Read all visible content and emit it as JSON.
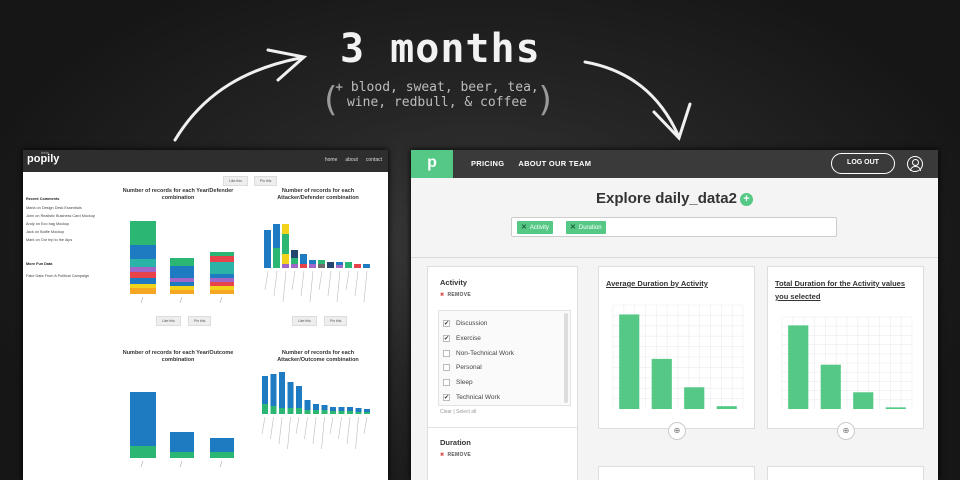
{
  "headline": "3 months",
  "extras_lines": [
    "+ blood, sweat, beer, tea,",
    "wine, redbull, & coffee"
  ],
  "old_app": {
    "logo": "popily",
    "logo_small": "beta",
    "nav": [
      "home",
      "about",
      "contact"
    ],
    "filter_buttons": [
      "Like this",
      "Pin this"
    ],
    "sidebar": {
      "recent_heading": "Recent Comments",
      "comments": [
        "Marla on Design Desk Essentials",
        "John on Realistic Business Card Mockup",
        "Andy on Eco bag Mockup",
        "Jack on Bottle Mockup",
        "Mark on Our trip to the Alps"
      ],
      "more_heading": "More Fun Data",
      "more_links": [
        "Fake Data From A Political Campaign"
      ]
    },
    "charts": [
      {
        "title": "Number of records for each Year/Defender combination",
        "buttons": [
          "Like this",
          "Pin this"
        ]
      },
      {
        "title": "Number of records for each Attacker/Defender combination",
        "buttons": [
          "Like this",
          "Pin this"
        ]
      },
      {
        "title": "Number of records for each Year/Outcome combination",
        "buttons": []
      },
      {
        "title": "Number of records for each Attacker/Outcome combination",
        "buttons": []
      }
    ],
    "colors": {
      "blue": "#1f7bc1",
      "green": "#2bb673",
      "purple": "#a066c8",
      "red": "#e8434b",
      "orange": "#f5a623",
      "yellow": "#f2d21b",
      "teal": "#2ab3a6",
      "navy": "#24466e",
      "gray": "#6d6d6d"
    }
  },
  "new_app": {
    "logo": "p",
    "nav": [
      "PRICING",
      "ABOUT OUR TEAM"
    ],
    "logout": "LOG OUT",
    "title": "Explore daily_data2",
    "add_icon": "+",
    "tags": [
      "Activity",
      "Duration"
    ],
    "filter_activity": {
      "heading": "Activity",
      "remove": "REMOVE",
      "options": [
        {
          "label": "Discussion",
          "checked": true
        },
        {
          "label": "Exercise",
          "checked": true
        },
        {
          "label": "Non-Technical Work",
          "checked": false
        },
        {
          "label": "Personal",
          "checked": false
        },
        {
          "label": "Sleep",
          "checked": false
        },
        {
          "label": "Technical Work",
          "checked": true
        }
      ],
      "clear_select": "Clear | Select all"
    },
    "filter_duration": {
      "heading": "Duration",
      "remove": "REMOVE"
    },
    "cards": [
      {
        "title_lines": [
          "Average Duration by Activity"
        ]
      },
      {
        "title_lines": [
          "Total Duration for the Activity values",
          "you selected"
        ]
      }
    ],
    "accent": "#55c886"
  },
  "chart_data": [
    {
      "type": "bar",
      "title": "Average Duration by Activity",
      "categories": [
        "",
        "",
        "",
        ""
      ],
      "values": [
        100,
        53,
        23,
        3
      ],
      "ylim": [
        0,
        110
      ],
      "grid": true
    },
    {
      "type": "bar",
      "title": "Total Duration for the Activity values you selected",
      "categories": [
        "",
        "",
        "",
        ""
      ],
      "values": [
        100,
        53,
        20,
        2
      ],
      "ylim": [
        0,
        110
      ],
      "grid": true
    }
  ]
}
